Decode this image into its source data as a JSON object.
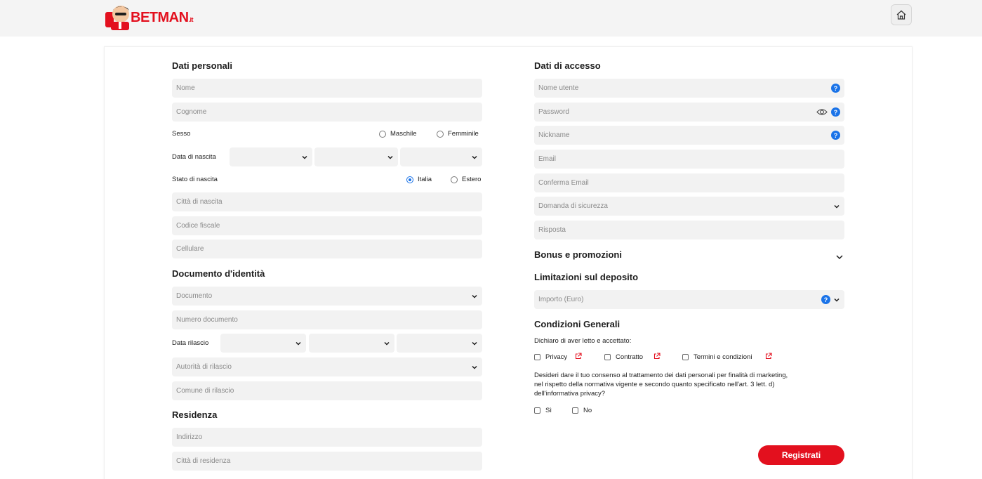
{
  "brand": {
    "name": "BETMAN",
    "tld": ".it"
  },
  "personal": {
    "title": "Dati personali",
    "nome": "Nome",
    "cognome": "Cognome",
    "sesso_label": "Sesso",
    "sesso_options": [
      "Maschile",
      "Femminile"
    ],
    "data_nascita_label": "Data di nascita",
    "stato_nascita_label": "Stato di nascita",
    "stato_options": [
      "Italia",
      "Estero"
    ],
    "stato_selected": "Italia",
    "citta_nascita": "Città di nascita",
    "codice_fiscale": "Codice fiscale",
    "cellulare": "Cellulare"
  },
  "document": {
    "title": "Documento d'identità",
    "documento": "Documento",
    "numero": "Numero documento",
    "data_rilascio_label": "Data rilascio",
    "autorita": "Autorità di rilascio",
    "comune": "Comune di rilascio"
  },
  "residence": {
    "title": "Residenza",
    "indirizzo": "Indirizzo",
    "citta": "Città di residenza"
  },
  "access": {
    "title": "Dati di accesso",
    "username": "Nome utente",
    "password": "Password",
    "nickname": "Nickname",
    "email": "Email",
    "confirm_email": "Conferma Email",
    "security_question": "Domanda di sicurezza",
    "answer": "Risposta"
  },
  "bonus": {
    "title": "Bonus e promozioni"
  },
  "deposit": {
    "title": "Limitazioni sul deposito",
    "amount": "Importo (Euro)"
  },
  "terms": {
    "title": "Condizioni Generali",
    "intro": "Dichiaro di aver letto e accettato:",
    "items": [
      "Privacy",
      "Contratto",
      "Termini e condizioni"
    ],
    "marketing_line1": "Desideri dare il tuo consenso al trattamento dei dati personali per finalità di marketing,",
    "marketing_line2": "nel rispetto della normativa vigente e secondo quanto specificato nell'art. 3 lett. d)",
    "marketing_line3": "dell'informativa privacy?",
    "consent_options": [
      "Sì",
      "No"
    ]
  },
  "submit_label": "Registrati",
  "colors": {
    "brand_red": "#e3101e",
    "accent_blue": "#1a73e8",
    "field_bg": "#f2f2f2"
  }
}
